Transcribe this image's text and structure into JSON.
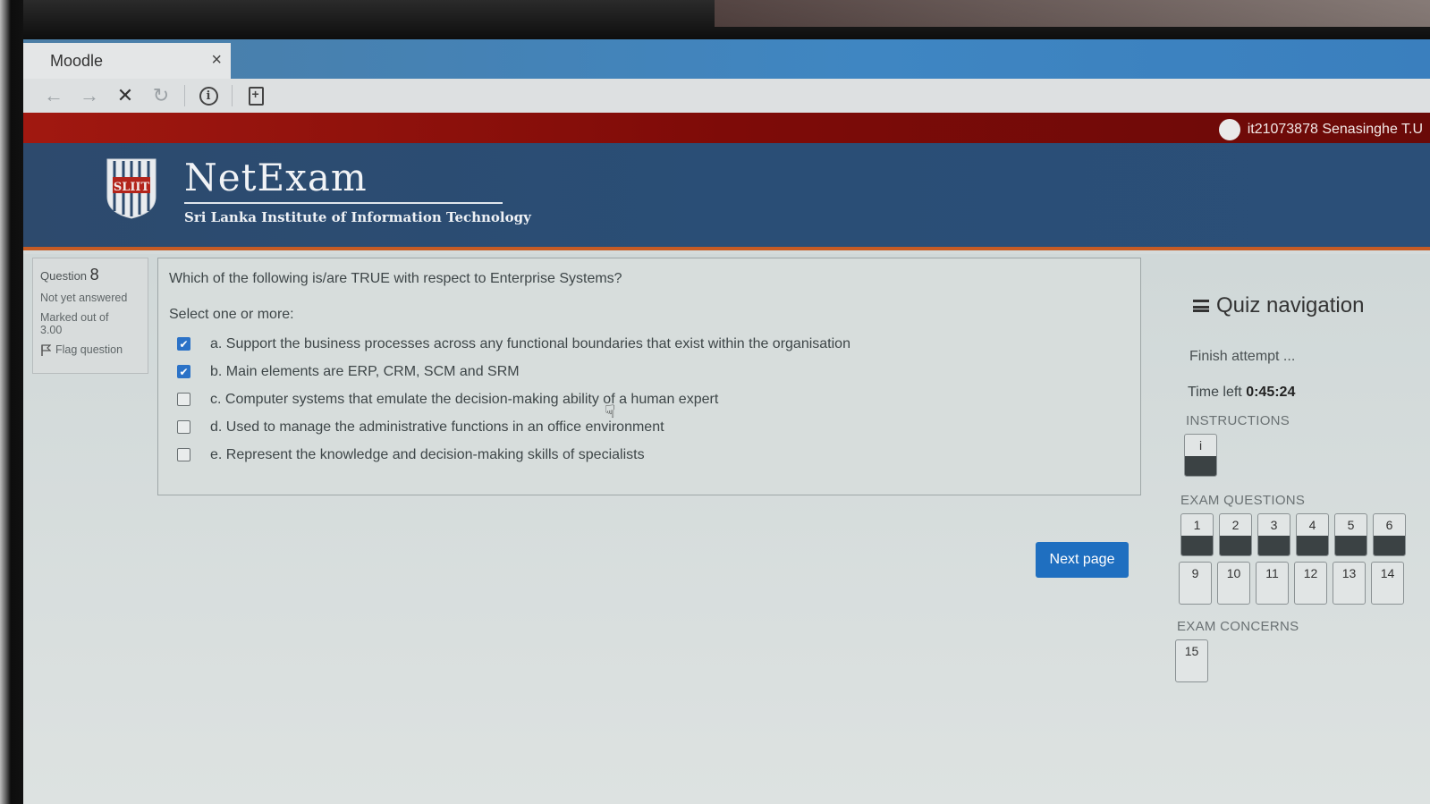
{
  "browser": {
    "tab_title": "Moodle",
    "tab_close": "×"
  },
  "site": {
    "brand_name": "NetExam",
    "brand_subtitle": "Sri Lanka Institute of Information Technology",
    "crest_text": "SLIIT",
    "user_name": "it21073878 Senasinghe T.U"
  },
  "question_info": {
    "label": "Question",
    "number": "8",
    "status": "Not yet answered",
    "marks_label": "Marked out of",
    "marks_value": "3.00",
    "flag_label": "Flag question"
  },
  "question": {
    "text": "Which of the following is/are TRUE with respect to Enterprise Systems?",
    "prompt": "Select one or more:",
    "options": [
      {
        "label": "a. Support the business processes across any functional boundaries that exist within the organisation",
        "checked": true
      },
      {
        "label": "b. Main elements are ERP, CRM, SCM and SRM",
        "checked": true
      },
      {
        "label": "c. Computer systems that emulate the decision-making ability of a human expert",
        "checked": false
      },
      {
        "label": "d. Used to manage the administrative functions in an office environment",
        "checked": false
      },
      {
        "label": "e. Represent the knowledge and decision-making skills of specialists",
        "checked": false
      }
    ]
  },
  "next_button": "Next page",
  "quiz_nav": {
    "title": "Quiz navigation",
    "finish": "Finish attempt ...",
    "time_label": "Time left",
    "time_value": "0:45:24",
    "instructions_label": "INSTRUCTIONS",
    "instructions_items": [
      {
        "n": "i",
        "done": true
      }
    ],
    "exam_questions_label": "EXAM QUESTIONS",
    "row1": [
      {
        "n": "1",
        "done": true
      },
      {
        "n": "2",
        "done": true
      },
      {
        "n": "3",
        "done": true
      },
      {
        "n": "4",
        "done": true
      },
      {
        "n": "5",
        "done": true
      },
      {
        "n": "6",
        "done": true
      }
    ],
    "row2": [
      {
        "n": "9",
        "done": false
      },
      {
        "n": "10",
        "done": false
      },
      {
        "n": "11",
        "done": false
      },
      {
        "n": "12",
        "done": false
      },
      {
        "n": "13",
        "done": false
      },
      {
        "n": "14",
        "done": false
      }
    ],
    "exam_concerns_label": "EXAM CONCERNS",
    "concerns": [
      {
        "n": "15",
        "done": false
      }
    ]
  }
}
